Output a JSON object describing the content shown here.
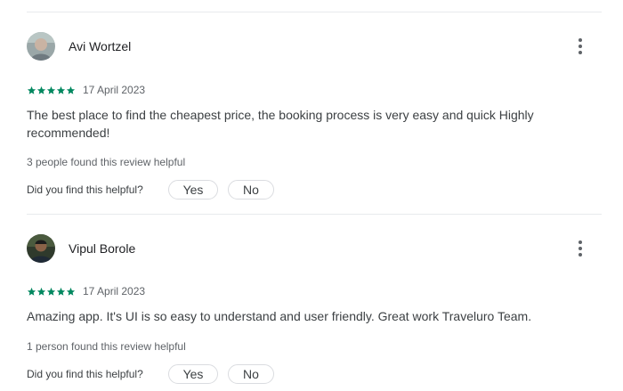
{
  "reviews": [
    {
      "author": "Avi Wortzel",
      "rating": 5,
      "date": "17 April 2023",
      "text": "The best place to find the cheapest price, the booking process is very easy and quick Highly recommended!",
      "helpful_count": "3 people found this review helpful",
      "question": "Did you find this helpful?",
      "yes_label": "Yes",
      "no_label": "No"
    },
    {
      "author": "Vipul Borole",
      "rating": 5,
      "date": "17 April 2023",
      "text": "Amazing app. It's UI is so easy to understand and user friendly. Great work Traveluro Team.",
      "helpful_count": "1 person found this review helpful",
      "question": "Did you find this helpful?",
      "yes_label": "Yes",
      "no_label": "No"
    }
  ],
  "icons": {
    "star": "star-icon",
    "menu": "more-vert-icon"
  },
  "colors": {
    "star": "#01875f",
    "divider": "#e8eaed"
  }
}
